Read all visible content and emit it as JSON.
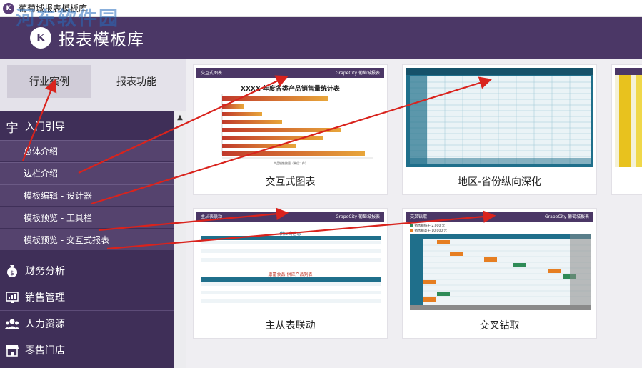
{
  "window": {
    "title": "葡萄城报表模板库",
    "app_icon": "K"
  },
  "watermark": "河东软件园",
  "header": {
    "brand": "报表模板库",
    "logo_letter": "K"
  },
  "tabs": [
    {
      "label": "行业案例",
      "active": true
    },
    {
      "label": "报表功能",
      "active": false
    }
  ],
  "sidebar": {
    "guide": {
      "label": "入门引导",
      "icon": "宇"
    },
    "guide_items": [
      "总体介绍",
      "边栏介绍",
      "模板编辑 - 设计器",
      "模板预览 - 工具栏",
      "模板预览 - 交互式报表"
    ],
    "sections": [
      {
        "label": "财务分析",
        "icon": "money-bag-icon"
      },
      {
        "label": "销售管理",
        "icon": "sales-chart-icon"
      },
      {
        "label": "人力资源",
        "icon": "people-icon"
      },
      {
        "label": "零售门店",
        "icon": "store-icon"
      }
    ]
  },
  "cards": [
    {
      "label": "交互式图表"
    },
    {
      "label": "地区-省份纵向深化"
    },
    {
      "label": "主从表联动"
    },
    {
      "label": "交叉钻取"
    }
  ],
  "thumb1": {
    "header": "交互式图表",
    "brand": "GrapeCity 葡萄城报表",
    "chart_title": "XXXX 年度各类产品销售量统计表",
    "x_axis": "产品销售数量（单位：件）"
  },
  "thumb3": {
    "header": "主从表联动",
    "brand": "GrapeCity 葡萄城报表",
    "section1": "供应商信息",
    "section2": "康富食品 供应产品列表"
  },
  "thumb4": {
    "header": "交叉钻取",
    "brand": "GrapeCity 葡萄城报表",
    "legend1": "销售额低于 2,000 元",
    "legend2": "销售额高于 10,000 元"
  },
  "colors": {
    "header": "#4b3766",
    "sidebar": "#3f2f58",
    "subitem": "#55436e",
    "accent_teal": "#1f6f8b",
    "arrow": "#d9231d"
  }
}
